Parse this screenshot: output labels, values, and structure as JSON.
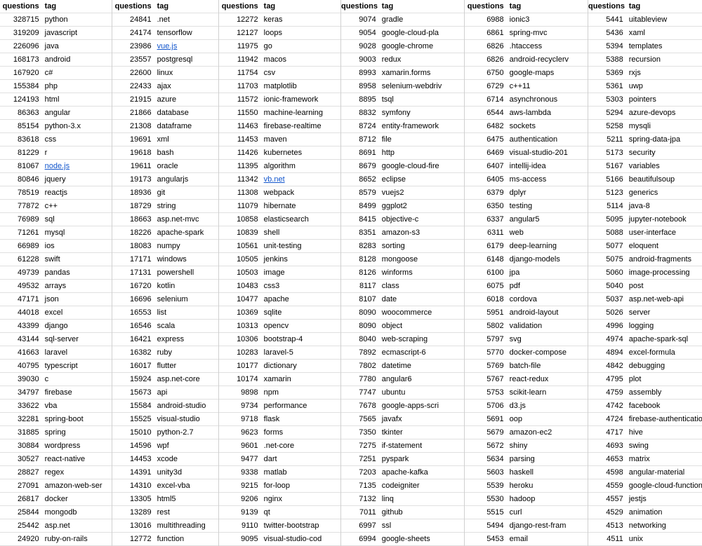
{
  "headers": {
    "questions": "questions",
    "tag": "tag"
  },
  "column_widths": [
    {
      "q": 60,
      "t": 100
    },
    {
      "q": 60,
      "t": 92
    },
    {
      "q": 60,
      "t": 114
    },
    {
      "q": 54,
      "t": 122
    },
    {
      "q": 60,
      "t": 116
    },
    {
      "q": 54,
      "t": 146
    }
  ],
  "columns": [
    [
      {
        "q": 328715,
        "t": "python"
      },
      {
        "q": 319209,
        "t": "javascript"
      },
      {
        "q": 226096,
        "t": "java"
      },
      {
        "q": 168173,
        "t": "android"
      },
      {
        "q": 167920,
        "t": "c#"
      },
      {
        "q": 155384,
        "t": "php"
      },
      {
        "q": 124193,
        "t": "html"
      },
      {
        "q": 86363,
        "t": "angular"
      },
      {
        "q": 85154,
        "t": "python-3.x"
      },
      {
        "q": 83618,
        "t": "css"
      },
      {
        "q": 81229,
        "t": "r"
      },
      {
        "q": 81067,
        "t": "node.js",
        "link": true
      },
      {
        "q": 80846,
        "t": "jquery"
      },
      {
        "q": 78519,
        "t": "reactjs"
      },
      {
        "q": 77872,
        "t": "c++"
      },
      {
        "q": 76989,
        "t": "sql"
      },
      {
        "q": 71261,
        "t": "mysql"
      },
      {
        "q": 66989,
        "t": "ios"
      },
      {
        "q": 61228,
        "t": "swift"
      },
      {
        "q": 49739,
        "t": "pandas"
      },
      {
        "q": 49532,
        "t": "arrays"
      },
      {
        "q": 47171,
        "t": "json"
      },
      {
        "q": 44018,
        "t": "excel"
      },
      {
        "q": 43399,
        "t": "django"
      },
      {
        "q": 43144,
        "t": "sql-server"
      },
      {
        "q": 41663,
        "t": "laravel"
      },
      {
        "q": 40795,
        "t": "typescript"
      },
      {
        "q": 39030,
        "t": "c"
      },
      {
        "q": 34797,
        "t": "firebase"
      },
      {
        "q": 33622,
        "t": "vba"
      },
      {
        "q": 32281,
        "t": "spring-boot"
      },
      {
        "q": 31885,
        "t": "spring"
      },
      {
        "q": 30884,
        "t": "wordpress"
      },
      {
        "q": 30527,
        "t": "react-native"
      },
      {
        "q": 28827,
        "t": "regex"
      },
      {
        "q": 27091,
        "t": "amazon-web-ser"
      },
      {
        "q": 26817,
        "t": "docker"
      },
      {
        "q": 25844,
        "t": "mongodb"
      },
      {
        "q": 25442,
        "t": "asp.net"
      },
      {
        "q": 24920,
        "t": "ruby-on-rails"
      }
    ],
    [
      {
        "q": 24841,
        "t": ".net"
      },
      {
        "q": 24174,
        "t": "tensorflow"
      },
      {
        "q": 23986,
        "t": "vue.js",
        "link": true
      },
      {
        "q": 23557,
        "t": "postgresql"
      },
      {
        "q": 22600,
        "t": "linux"
      },
      {
        "q": 22433,
        "t": "ajax"
      },
      {
        "q": 21915,
        "t": "azure"
      },
      {
        "q": 21866,
        "t": "database"
      },
      {
        "q": 21308,
        "t": "dataframe"
      },
      {
        "q": 19691,
        "t": "xml"
      },
      {
        "q": 19618,
        "t": "bash"
      },
      {
        "q": 19611,
        "t": "oracle"
      },
      {
        "q": 19173,
        "t": "angularjs"
      },
      {
        "q": 18936,
        "t": "git"
      },
      {
        "q": 18729,
        "t": "string"
      },
      {
        "q": 18663,
        "t": "asp.net-mvc"
      },
      {
        "q": 18226,
        "t": "apache-spark"
      },
      {
        "q": 18083,
        "t": "numpy"
      },
      {
        "q": 17171,
        "t": "windows"
      },
      {
        "q": 17131,
        "t": "powershell"
      },
      {
        "q": 16720,
        "t": "kotlin"
      },
      {
        "q": 16696,
        "t": "selenium"
      },
      {
        "q": 16553,
        "t": "list"
      },
      {
        "q": 16546,
        "t": "scala"
      },
      {
        "q": 16421,
        "t": "express"
      },
      {
        "q": 16382,
        "t": "ruby"
      },
      {
        "q": 16017,
        "t": "flutter"
      },
      {
        "q": 15924,
        "t": "asp.net-core"
      },
      {
        "q": 15673,
        "t": "api"
      },
      {
        "q": 15584,
        "t": "android-studio"
      },
      {
        "q": 15525,
        "t": "visual-studio"
      },
      {
        "q": 15010,
        "t": "python-2.7"
      },
      {
        "q": 14596,
        "t": "wpf"
      },
      {
        "q": 14453,
        "t": "xcode"
      },
      {
        "q": 14391,
        "t": "unity3d"
      },
      {
        "q": 14310,
        "t": "excel-vba"
      },
      {
        "q": 13305,
        "t": "html5"
      },
      {
        "q": 13289,
        "t": "rest"
      },
      {
        "q": 13016,
        "t": "multithreading"
      },
      {
        "q": 12772,
        "t": "function"
      }
    ],
    [
      {
        "q": 12272,
        "t": "keras"
      },
      {
        "q": 12127,
        "t": "loops"
      },
      {
        "q": 11975,
        "t": "go"
      },
      {
        "q": 11942,
        "t": "macos"
      },
      {
        "q": 11754,
        "t": "csv"
      },
      {
        "q": 11703,
        "t": "matplotlib"
      },
      {
        "q": 11572,
        "t": "ionic-framework"
      },
      {
        "q": 11550,
        "t": "machine-learning"
      },
      {
        "q": 11463,
        "t": "firebase-realtime"
      },
      {
        "q": 11453,
        "t": "maven"
      },
      {
        "q": 11426,
        "t": "kubernetes"
      },
      {
        "q": 11395,
        "t": "algorithm"
      },
      {
        "q": 11342,
        "t": "vb.net",
        "link": true
      },
      {
        "q": 11308,
        "t": "webpack"
      },
      {
        "q": 11079,
        "t": "hibernate"
      },
      {
        "q": 10858,
        "t": "elasticsearch"
      },
      {
        "q": 10839,
        "t": "shell"
      },
      {
        "q": 10561,
        "t": "unit-testing"
      },
      {
        "q": 10505,
        "t": "jenkins"
      },
      {
        "q": 10503,
        "t": "image"
      },
      {
        "q": 10483,
        "t": "css3"
      },
      {
        "q": 10477,
        "t": "apache"
      },
      {
        "q": 10369,
        "t": "sqlite"
      },
      {
        "q": 10313,
        "t": "opencv"
      },
      {
        "q": 10306,
        "t": "bootstrap-4"
      },
      {
        "q": 10283,
        "t": "laravel-5"
      },
      {
        "q": 10177,
        "t": "dictionary"
      },
      {
        "q": 10174,
        "t": "xamarin"
      },
      {
        "q": 9898,
        "t": "npm"
      },
      {
        "q": 9734,
        "t": "performance"
      },
      {
        "q": 9718,
        "t": "flask"
      },
      {
        "q": 9623,
        "t": "forms"
      },
      {
        "q": 9601,
        "t": ".net-core"
      },
      {
        "q": 9477,
        "t": "dart"
      },
      {
        "q": 9338,
        "t": "matlab"
      },
      {
        "q": 9215,
        "t": "for-loop"
      },
      {
        "q": 9206,
        "t": "nginx"
      },
      {
        "q": 9139,
        "t": "qt"
      },
      {
        "q": 9110,
        "t": "twitter-bootstrap"
      },
      {
        "q": 9095,
        "t": "visual-studio-cod"
      }
    ],
    [
      {
        "q": 9074,
        "t": "gradle"
      },
      {
        "q": 9054,
        "t": "google-cloud-pla"
      },
      {
        "q": 9028,
        "t": "google-chrome"
      },
      {
        "q": 9003,
        "t": "redux"
      },
      {
        "q": 8993,
        "t": "xamarin.forms"
      },
      {
        "q": 8958,
        "t": "selenium-webdriv"
      },
      {
        "q": 8895,
        "t": "tsql"
      },
      {
        "q": 8832,
        "t": "symfony"
      },
      {
        "q": 8724,
        "t": "entity-framework"
      },
      {
        "q": 8712,
        "t": "file"
      },
      {
        "q": 8691,
        "t": "http"
      },
      {
        "q": 8679,
        "t": "google-cloud-fire"
      },
      {
        "q": 8652,
        "t": "eclipse"
      },
      {
        "q": 8579,
        "t": "vuejs2"
      },
      {
        "q": 8499,
        "t": "ggplot2"
      },
      {
        "q": 8415,
        "t": "objective-c"
      },
      {
        "q": 8351,
        "t": "amazon-s3"
      },
      {
        "q": 8283,
        "t": "sorting"
      },
      {
        "q": 8128,
        "t": "mongoose"
      },
      {
        "q": 8126,
        "t": "winforms"
      },
      {
        "q": 8117,
        "t": "class"
      },
      {
        "q": 8107,
        "t": "date"
      },
      {
        "q": 8090,
        "t": "woocommerce"
      },
      {
        "q": 8090,
        "t": "object"
      },
      {
        "q": 8040,
        "t": "web-scraping"
      },
      {
        "q": 7892,
        "t": "ecmascript-6"
      },
      {
        "q": 7802,
        "t": "datetime"
      },
      {
        "q": 7780,
        "t": "angular6"
      },
      {
        "q": 7747,
        "t": "ubuntu"
      },
      {
        "q": 7678,
        "t": "google-apps-scri"
      },
      {
        "q": 7565,
        "t": "javafx"
      },
      {
        "q": 7350,
        "t": "tkinter"
      },
      {
        "q": 7275,
        "t": "if-statement"
      },
      {
        "q": 7251,
        "t": "pyspark"
      },
      {
        "q": 7203,
        "t": "apache-kafka"
      },
      {
        "q": 7135,
        "t": "codeigniter"
      },
      {
        "q": 7132,
        "t": "linq"
      },
      {
        "q": 7011,
        "t": "github"
      },
      {
        "q": 6997,
        "t": "ssl"
      },
      {
        "q": 6994,
        "t": "google-sheets"
      }
    ],
    [
      {
        "q": 6988,
        "t": "ionic3"
      },
      {
        "q": 6861,
        "t": "spring-mvc"
      },
      {
        "q": 6826,
        "t": ".htaccess"
      },
      {
        "q": 6826,
        "t": "android-recyclerv"
      },
      {
        "q": 6750,
        "t": "google-maps"
      },
      {
        "q": 6729,
        "t": "c++11"
      },
      {
        "q": 6714,
        "t": "asynchronous"
      },
      {
        "q": 6544,
        "t": "aws-lambda"
      },
      {
        "q": 6482,
        "t": "sockets"
      },
      {
        "q": 6475,
        "t": "authentication"
      },
      {
        "q": 6469,
        "t": "visual-studio-201"
      },
      {
        "q": 6407,
        "t": "intellij-idea"
      },
      {
        "q": 6405,
        "t": "ms-access"
      },
      {
        "q": 6379,
        "t": "dplyr"
      },
      {
        "q": 6350,
        "t": "testing"
      },
      {
        "q": 6337,
        "t": "angular5"
      },
      {
        "q": 6311,
        "t": "web"
      },
      {
        "q": 6179,
        "t": "deep-learning"
      },
      {
        "q": 6148,
        "t": "django-models"
      },
      {
        "q": 6100,
        "t": "jpa"
      },
      {
        "q": 6075,
        "t": "pdf"
      },
      {
        "q": 6018,
        "t": "cordova"
      },
      {
        "q": 5951,
        "t": "android-layout"
      },
      {
        "q": 5802,
        "t": "validation"
      },
      {
        "q": 5797,
        "t": "svg"
      },
      {
        "q": 5770,
        "t": "docker-compose"
      },
      {
        "q": 5769,
        "t": "batch-file"
      },
      {
        "q": 5767,
        "t": "react-redux"
      },
      {
        "q": 5753,
        "t": "scikit-learn"
      },
      {
        "q": 5706,
        "t": "d3.js"
      },
      {
        "q": 5691,
        "t": "oop"
      },
      {
        "q": 5679,
        "t": "amazon-ec2"
      },
      {
        "q": 5672,
        "t": "shiny"
      },
      {
        "q": 5634,
        "t": "parsing"
      },
      {
        "q": 5603,
        "t": "haskell"
      },
      {
        "q": 5539,
        "t": "heroku"
      },
      {
        "q": 5530,
        "t": "hadoop"
      },
      {
        "q": 5515,
        "t": "curl"
      },
      {
        "q": 5494,
        "t": "django-rest-fram"
      },
      {
        "q": 5453,
        "t": "email"
      }
    ],
    [
      {
        "q": 5441,
        "t": "uitableview"
      },
      {
        "q": 5436,
        "t": "xaml"
      },
      {
        "q": 5394,
        "t": "templates"
      },
      {
        "q": 5388,
        "t": "recursion"
      },
      {
        "q": 5369,
        "t": "rxjs"
      },
      {
        "q": 5361,
        "t": "uwp"
      },
      {
        "q": 5303,
        "t": "pointers"
      },
      {
        "q": 5294,
        "t": "azure-devops"
      },
      {
        "q": 5258,
        "t": "mysqli"
      },
      {
        "q": 5211,
        "t": "spring-data-jpa"
      },
      {
        "q": 5173,
        "t": "security"
      },
      {
        "q": 5167,
        "t": "variables"
      },
      {
        "q": 5166,
        "t": "beautifulsoup"
      },
      {
        "q": 5123,
        "t": "generics"
      },
      {
        "q": 5114,
        "t": "java-8"
      },
      {
        "q": 5095,
        "t": "jupyter-notebook"
      },
      {
        "q": 5088,
        "t": "user-interface"
      },
      {
        "q": 5077,
        "t": "eloquent"
      },
      {
        "q": 5075,
        "t": "android-fragments"
      },
      {
        "q": 5060,
        "t": "image-processing"
      },
      {
        "q": 5040,
        "t": "post"
      },
      {
        "q": 5037,
        "t": "asp.net-web-api"
      },
      {
        "q": 5026,
        "t": "server"
      },
      {
        "q": 4996,
        "t": "logging"
      },
      {
        "q": 4974,
        "t": "apache-spark-sql"
      },
      {
        "q": 4894,
        "t": "excel-formula"
      },
      {
        "q": 4842,
        "t": "debugging"
      },
      {
        "q": 4795,
        "t": "plot"
      },
      {
        "q": 4759,
        "t": "assembly"
      },
      {
        "q": 4742,
        "t": "facebook"
      },
      {
        "q": 4724,
        "t": "firebase-authentication"
      },
      {
        "q": 4717,
        "t": "hive"
      },
      {
        "q": 4693,
        "t": "swing"
      },
      {
        "q": 4653,
        "t": "matrix"
      },
      {
        "q": 4598,
        "t": "angular-material"
      },
      {
        "q": 4559,
        "t": "google-cloud-functions"
      },
      {
        "q": 4557,
        "t": "jestjs"
      },
      {
        "q": 4529,
        "t": "animation"
      },
      {
        "q": 4513,
        "t": "networking"
      },
      {
        "q": 4511,
        "t": "unix"
      }
    ]
  ]
}
